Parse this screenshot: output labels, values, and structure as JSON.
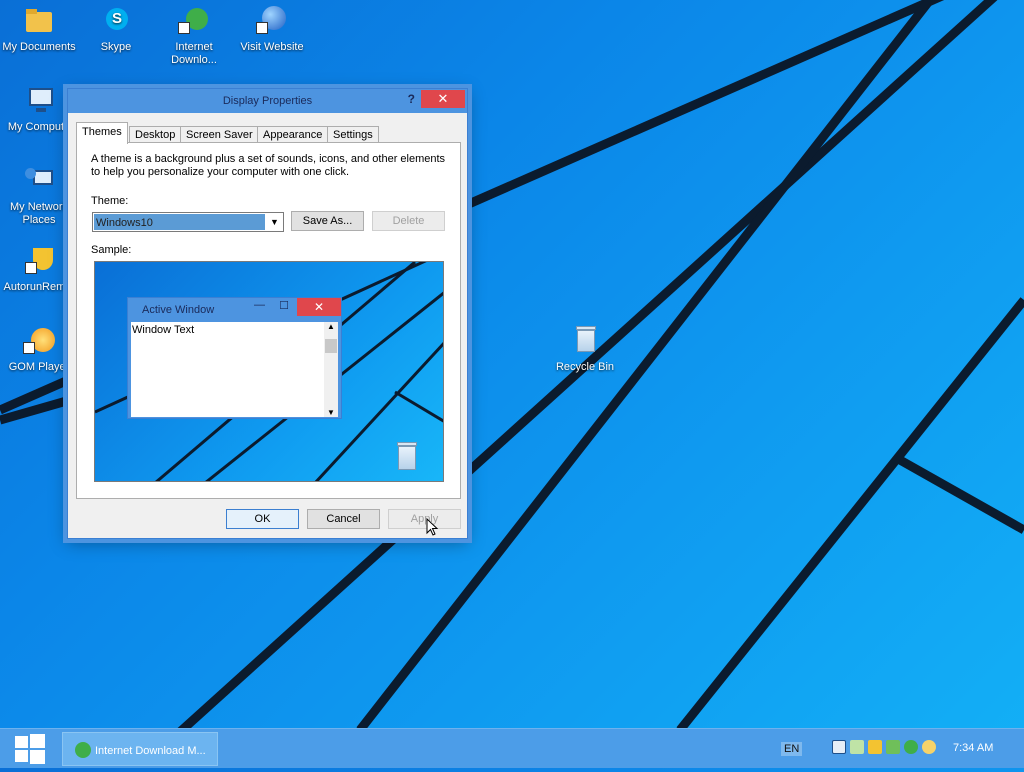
{
  "desktop_icons": [
    {
      "label": "My Documents"
    },
    {
      "label": "Skype"
    },
    {
      "label": "Internet Downlo..."
    },
    {
      "label": "Visit Website"
    },
    {
      "label": "My Compute"
    },
    {
      "label": "My Network Places"
    },
    {
      "label": "AutorunRem..."
    },
    {
      "label": "GOM Player"
    },
    {
      "label": "Recycle Bin"
    }
  ],
  "dialog": {
    "title": "Display Properties",
    "help": "?",
    "close": "✕",
    "tabs": [
      "Themes",
      "Desktop",
      "Screen Saver",
      "Appearance",
      "Settings"
    ],
    "active_tab": "Themes",
    "description": "A theme is a background plus a set of sounds, icons, and other elements to help you personalize your computer with one click.",
    "theme_label": "Theme:",
    "theme_value": "Windows10",
    "save_as": "Save As...",
    "delete": "Delete",
    "sample_label": "Sample:",
    "sample": {
      "window_title": "Active Window",
      "window_text": "Window Text",
      "min": "—",
      "max": "☐",
      "close": "✕"
    },
    "ok": "OK",
    "cancel": "Cancel",
    "apply": "Apply"
  },
  "taskbar": {
    "task_label": "Internet Download M...",
    "language": "EN",
    "clock": "7:34 AM"
  },
  "colors": {
    "accent": "#4d94e0",
    "close": "#e0474c",
    "taskbar": "#4c9de8"
  }
}
